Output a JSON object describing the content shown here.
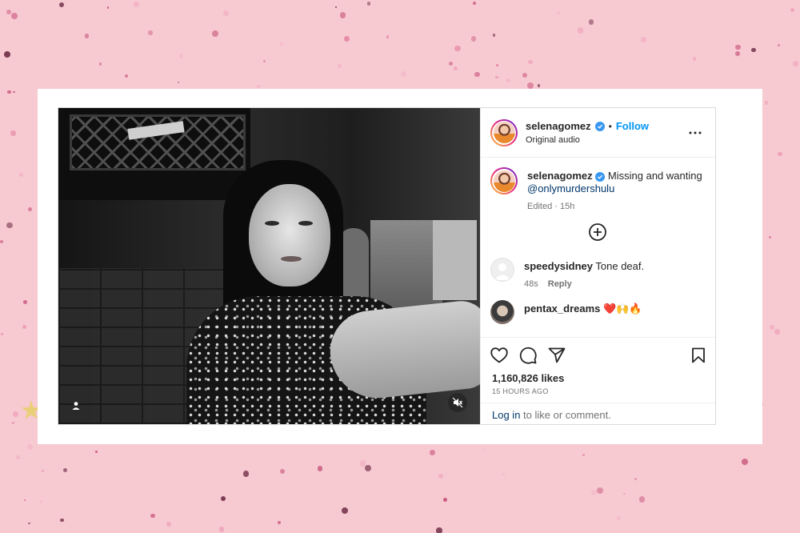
{
  "background": {
    "color": "#f7c9d1"
  },
  "post": {
    "username": "selenagomez",
    "follow_label": "Follow",
    "separator": "•",
    "audio_label": "Original audio",
    "caption": {
      "username": "selenagomez",
      "text": "Missing and wanting",
      "mention": "@onlymurdershulu",
      "edited": "Edited",
      "time": "15h"
    },
    "comments": [
      {
        "username": "speedysidney",
        "text": "Tone deaf.",
        "time": "48s",
        "reply_label": "Reply"
      },
      {
        "username": "pentax_dreams",
        "text": "❤️🙌🔥"
      }
    ],
    "likes": "1,160,826 likes",
    "time_ago": "15 HOURS AGO",
    "login_link": "Log in",
    "login_text": "to like or comment."
  },
  "colors": {
    "link": "#0095f6",
    "mention": "#00376b",
    "verified": "#3897f0"
  },
  "icons": [
    "user-tag-icon",
    "mute-icon",
    "more-options-icon",
    "load-more-icon",
    "heart-icon",
    "comment-icon",
    "share-icon",
    "bookmark-icon",
    "verified-badge-icon"
  ]
}
